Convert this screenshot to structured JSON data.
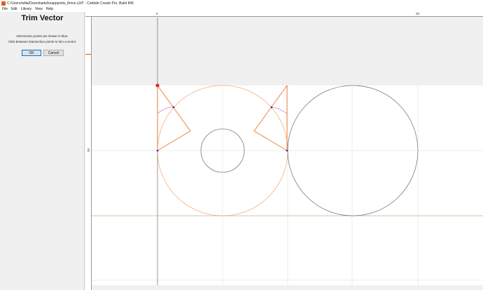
{
  "window": {
    "title": "C:/Users/willa/Downloads/knappjoints_thrice.c2d* - Carbide Create Pro, Build 845"
  },
  "menu": {
    "items": [
      "File",
      "Edit",
      "Library",
      "View",
      "Help"
    ]
  },
  "panel": {
    "title": "Trim Vector",
    "line1": "Intersection points are shown in blue.",
    "line2": "Click between intersection points to trim a vector.",
    "ok_label": "OK",
    "cancel_label": "Cancel"
  },
  "rulers": {
    "top_labels": [
      "0",
      "20"
    ],
    "left_label": "20"
  },
  "colors": {
    "orange": "#f07a2a",
    "gray_vector": "#7a7a7a",
    "intersection": "#2a2ad0",
    "trim_preview": "#e070e0",
    "selection": "#e02020",
    "olive_guide": "#b8b890"
  }
}
